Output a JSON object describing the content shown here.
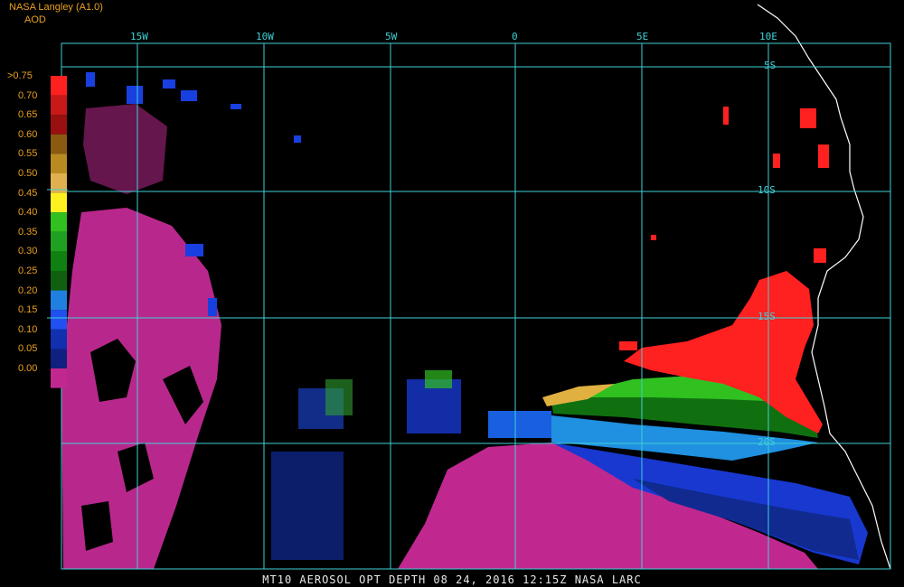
{
  "header": {
    "source": "NASA Langley (A1.0)",
    "variable": "AOD"
  },
  "legend": {
    "labels": [
      ">0.75",
      "0.70",
      "0.65",
      "0.60",
      "0.55",
      "0.50",
      "0.45",
      "0.40",
      "0.35",
      "0.30",
      "0.25",
      "0.20",
      "0.15",
      "0.10",
      "0.05",
      "0.00"
    ],
    "colors": [
      "#ff2020",
      "#c81818",
      "#9a1010",
      "#8a5a10",
      "#b88a20",
      "#e0b050",
      "#fff020",
      "#30c020",
      "#20a020",
      "#108010",
      "#106010",
      "#2080e0",
      "#2050f0",
      "#1030b0",
      "#102080",
      "#c02890"
    ]
  },
  "longitudes": [
    "15W",
    "10W",
    "5W",
    "0",
    "5E",
    "10E"
  ],
  "latitudes": [
    "5S",
    "10S",
    "15S",
    "20S"
  ],
  "footer": "MT10  AEROSOL OPT DEPTH  08 24, 2016 12:15Z  NASA LARC",
  "colors": {
    "grid": "#3fd0d6",
    "coast": "#ffffff",
    "label": "#e8a020"
  }
}
